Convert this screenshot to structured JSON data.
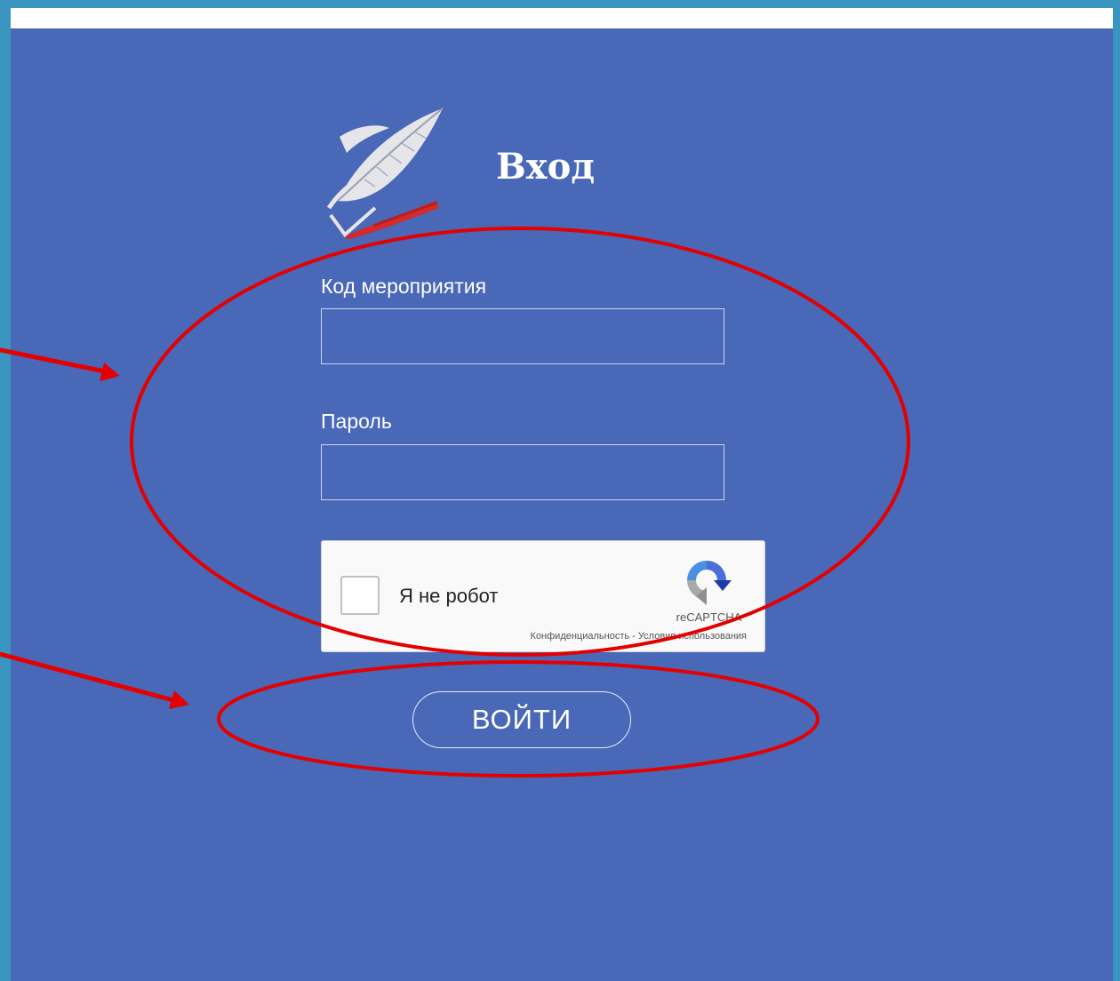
{
  "form": {
    "title": "Вход",
    "code_label": "Код мероприятия",
    "code_value": "",
    "password_label": "Пароль",
    "password_value": "",
    "login_button": "ВОЙТИ"
  },
  "captcha": {
    "checkbox_label": "Я не робот",
    "brand": "reCAPTCHA",
    "privacy_link": "Конфиденциальность",
    "separator": " - ",
    "terms_link": "Условия использования"
  },
  "colors": {
    "page_border": "#3a95c1",
    "background": "#4968b8",
    "top_bar": "#ffffff",
    "annotation": "#e30000",
    "logo_feather": "#e6e6ea",
    "logo_stroke": "#d42a2a"
  },
  "icons": {
    "logo": "feather-quill-logo",
    "captcha": "recaptcha-logo-icon"
  }
}
